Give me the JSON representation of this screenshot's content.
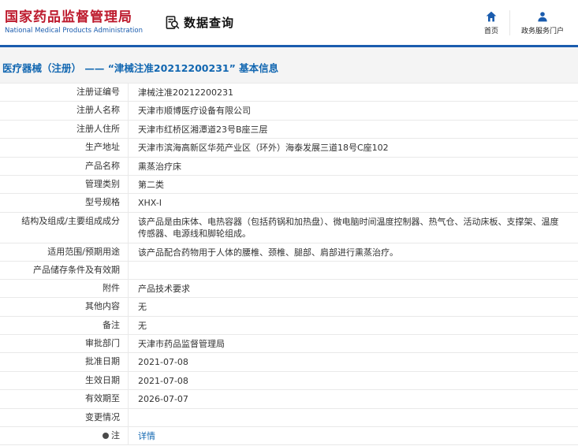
{
  "colors": {
    "brand_red": "#bd1a2d",
    "brand_blue": "#1a5cae",
    "link_blue": "#1267b1"
  },
  "header": {
    "logo_title": "国家药品监督管理局",
    "logo_subtitle": "National Medical Products Administration",
    "section_title": "数据查询",
    "nav": [
      {
        "icon": "home-icon",
        "label": "首页"
      },
      {
        "icon": "person-icon",
        "label": "政务服务门户"
      }
    ]
  },
  "breadcrumb": {
    "text": "医疗器械（注册） —— “津械注准20212200231” 基本信息"
  },
  "table": {
    "rows": [
      {
        "label": "注册证编号",
        "value": "津械注准20212200231"
      },
      {
        "label": "注册人名称",
        "value": "天津市顺博医疗设备有限公司"
      },
      {
        "label": "注册人住所",
        "value": "天津市红桥区湘潭道23号B座三层"
      },
      {
        "label": "生产地址",
        "value": "天津市滨海高新区华苑产业区（环外）海泰发展三道18号C座102"
      },
      {
        "label": "产品名称",
        "value": "熏蒸治疗床"
      },
      {
        "label": "管理类别",
        "value": "第二类"
      },
      {
        "label": "型号规格",
        "value": "XHX-Ⅰ"
      },
      {
        "label": "结构及组成/主要组成成分",
        "value": "该产品是由床体、电热容器（包括药锅和加热盘）、微电脑时间温度控制器、热气仓、活动床板、支撑架、温度传感器、电源线和脚轮组成。"
      },
      {
        "label": "适用范围/预期用途",
        "value": "该产品配合药物用于人体的腰椎、颈椎、腿部、肩部进行熏蒸治疗。"
      },
      {
        "label": "产品储存条件及有效期",
        "value": ""
      },
      {
        "label": "附件",
        "value": "产品技术要求"
      },
      {
        "label": "其他内容",
        "value": "无"
      },
      {
        "label": "备注",
        "value": "无"
      },
      {
        "label": "审批部门",
        "value": "天津市药品监督管理局"
      },
      {
        "label": "批准日期",
        "value": "2021-07-08"
      },
      {
        "label": "生效日期",
        "value": "2021-07-08"
      },
      {
        "label": "有效期至",
        "value": "2026-07-07"
      },
      {
        "label": "变更情况",
        "value": ""
      },
      {
        "label": "注",
        "value": "详情"
      }
    ]
  }
}
